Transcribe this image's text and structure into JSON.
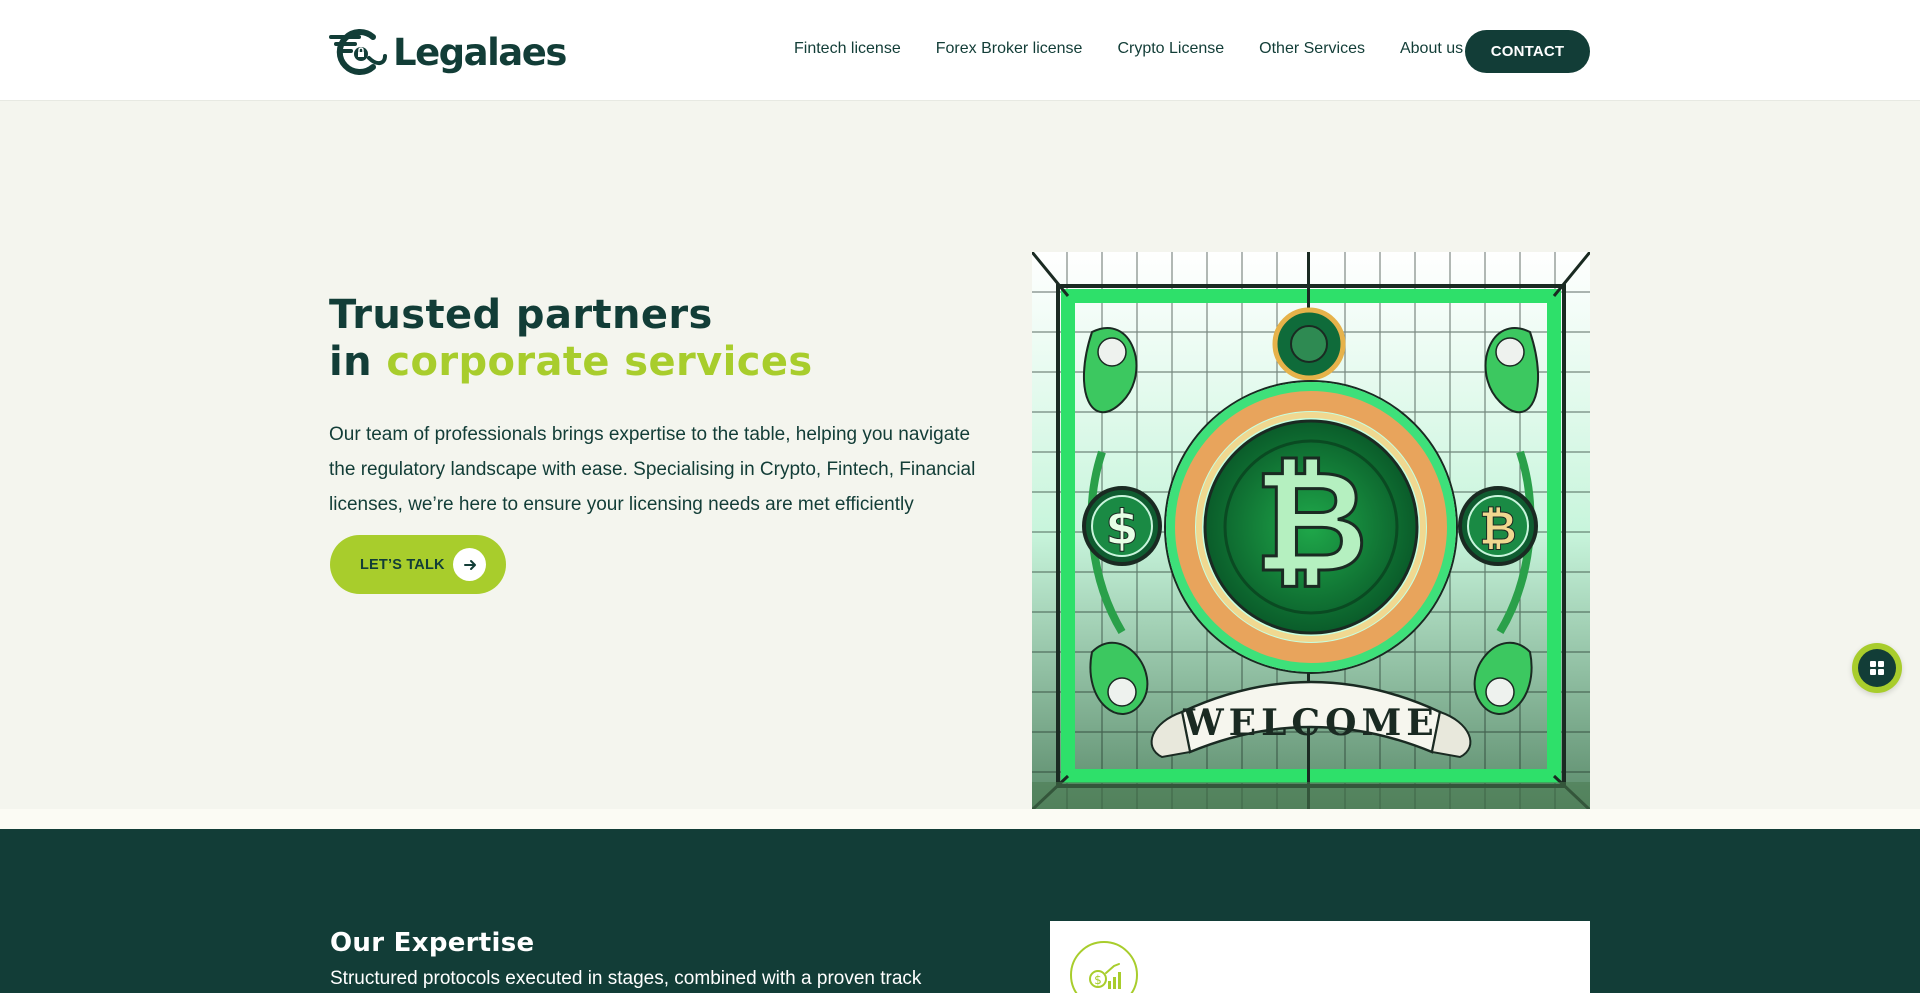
{
  "brand": {
    "name": "Legalaes"
  },
  "nav": {
    "links": [
      "Fintech license",
      "Forex Broker license",
      "Crypto License",
      "Other Services",
      "About us"
    ],
    "contact": "CONTACT"
  },
  "hero": {
    "title_line1": "Trusted partners",
    "title_line2_prefix": "in ",
    "title_line2_accent": "corporate services",
    "description": "Our team of professionals brings expertise to the table, helping you navigate the regulatory landscape with ease. Specialising in Crypto, Fintech, Financial licenses, we’re here to ensure your licensing needs are met efficiently",
    "cta": "LET’S TALK",
    "image_text": "WELCOME"
  },
  "expertise": {
    "title": "Our Expertise",
    "subtitle": "Structured protocols executed in stages, combined with a proven track"
  },
  "icons": {
    "cta_arrow": "arrow-right-icon",
    "widget": "grid-icon",
    "card": "money-growth-icon"
  },
  "colors": {
    "primary": "#123d37",
    "accent": "#a8cd2c",
    "background": "#f4f5ee"
  }
}
